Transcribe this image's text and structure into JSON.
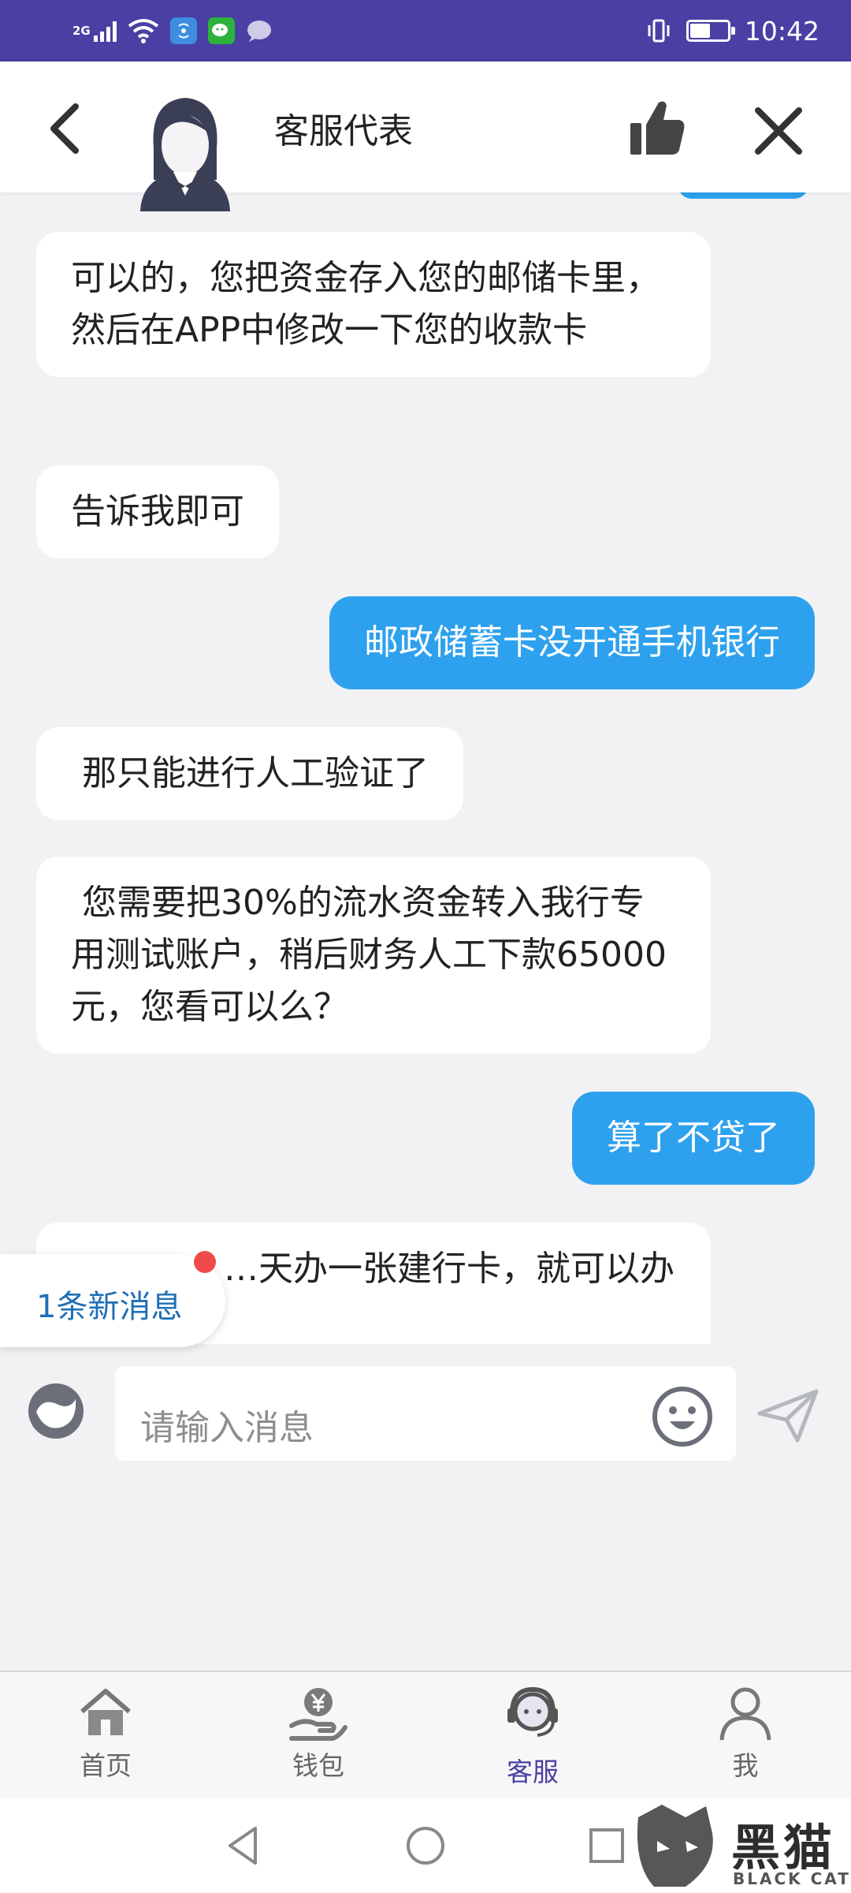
{
  "status_bar": {
    "network": "2G",
    "time": "10:42",
    "battery_level_percent": 55,
    "icons": [
      "signal-icon",
      "wifi-icon",
      "hotspot-icon",
      "wechat-icon",
      "message-icon",
      "vibrate-icon",
      "battery-icon"
    ]
  },
  "header": {
    "title": "客服代表",
    "icons": [
      "back-icon",
      "agent-avatar",
      "thumbs-up-icon",
      "close-icon"
    ]
  },
  "messages": [
    {
      "side": "in",
      "text": "可以的，您把资金存入您的邮储卡里，然后在APP中修改一下您的收款卡"
    },
    {
      "side": "in",
      "text": "告诉我即可"
    },
    {
      "side": "out",
      "text": "邮政储蓄卡没开通手机银行"
    },
    {
      "side": "in",
      "text": " 那只能进行人工验证了"
    },
    {
      "side": "in",
      "text": " 您需要把30%的流水资金转入我行专用测试账户，稍后财务人工下款65000元，您看可以么？"
    },
    {
      "side": "out",
      "text": "算了不贷了"
    },
    {
      "side": "in",
      "text": "…天办一张建行卡，就可以办"
    }
  ],
  "new_message_badge": "1条新消息",
  "input": {
    "placeholder": "请输入消息",
    "icons": [
      "voice-icon",
      "emoji-icon",
      "send-icon"
    ]
  },
  "bottom_nav": {
    "items": [
      {
        "label": "首页",
        "icon": "home-icon"
      },
      {
        "label": "钱包",
        "icon": "wallet-icon"
      },
      {
        "label": "客服",
        "icon": "customer-service-icon",
        "active": true
      },
      {
        "label": "我",
        "icon": "profile-icon"
      }
    ]
  },
  "system_nav": [
    "back-triangle-icon",
    "home-circle-icon",
    "recents-square-icon"
  ],
  "watermark": {
    "text": "黑猫",
    "subtext": "BLACK CAT"
  },
  "colors": {
    "status_bar": "#4a3fa3",
    "outgoing_bubble": "#2ea1ee",
    "incoming_bubble": "#ffffff",
    "background": "#f2f2f4",
    "active_nav": "#4a3fa3",
    "badge_dot": "#f04a4a"
  }
}
